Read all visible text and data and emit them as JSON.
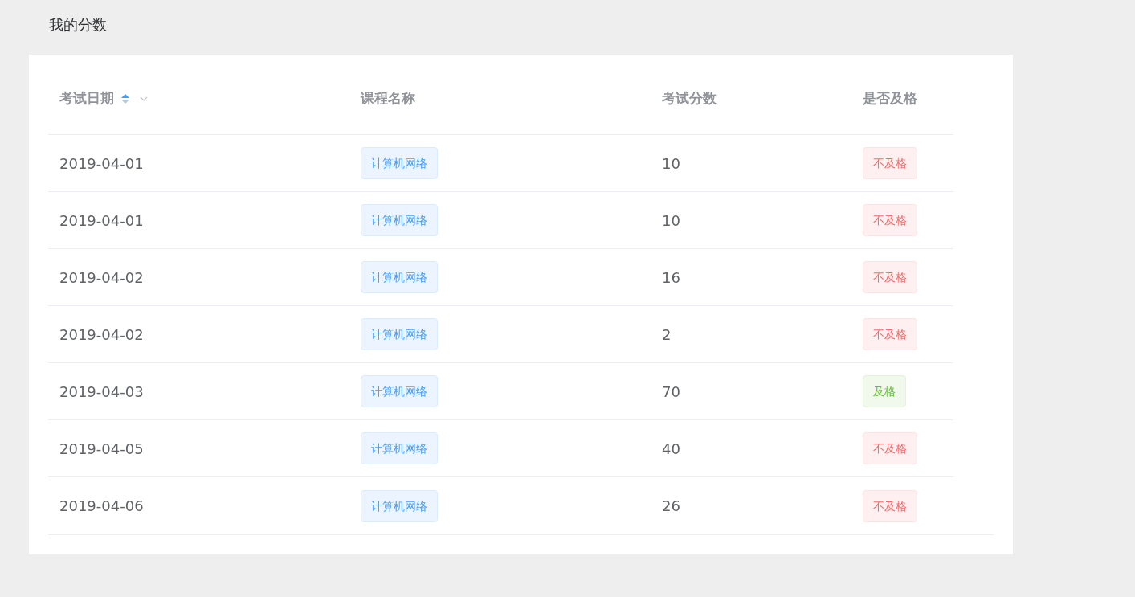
{
  "page_title": "我的分数",
  "table": {
    "columns": [
      {
        "label": "考试日期",
        "sortable": true,
        "sort_ascending": true,
        "sort_descending": false,
        "filter": true
      },
      {
        "label": "课程名称"
      },
      {
        "label": "考试分数"
      },
      {
        "label": "是否及格"
      }
    ],
    "rows": [
      {
        "date": "2019-04-01",
        "course": "计算机网络",
        "score": "10",
        "result": "不及格",
        "passed": false
      },
      {
        "date": "2019-04-01",
        "course": "计算机网络",
        "score": "10",
        "result": "不及格",
        "passed": false
      },
      {
        "date": "2019-04-02",
        "course": "计算机网络",
        "score": "16",
        "result": "不及格",
        "passed": false
      },
      {
        "date": "2019-04-02",
        "course": "计算机网络",
        "score": "2",
        "result": "不及格",
        "passed": false
      },
      {
        "date": "2019-04-03",
        "course": "计算机网络",
        "score": "70",
        "result": "及格",
        "passed": true
      },
      {
        "date": "2019-04-05",
        "course": "计算机网络",
        "score": "40",
        "result": "不及格",
        "passed": false
      },
      {
        "date": "2019-04-06",
        "course": "计算机网络",
        "score": "26",
        "result": "不及格",
        "passed": false
      }
    ]
  }
}
